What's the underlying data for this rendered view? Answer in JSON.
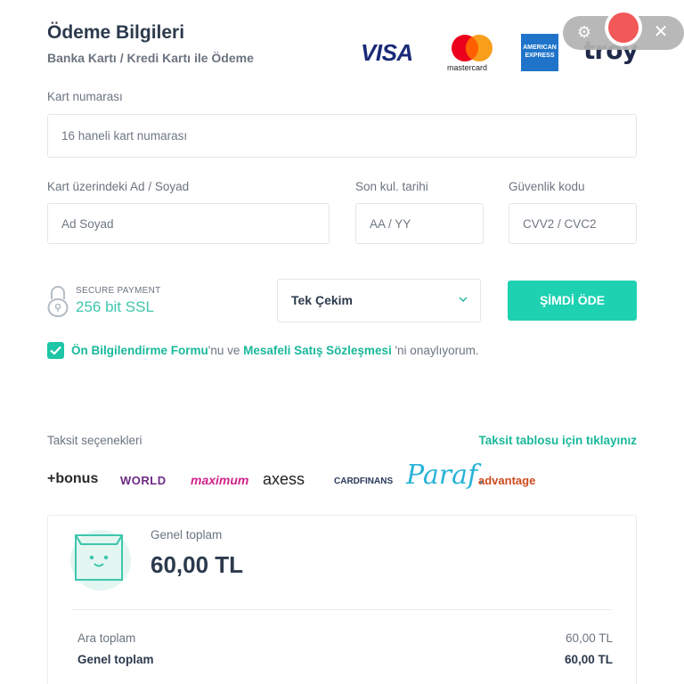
{
  "header": {
    "title": "Ödeme Bilgileri",
    "subtitle": "Banka Kartı / Kredi Kartı ile Ödeme"
  },
  "card_brands": {
    "visa": "VISA",
    "mastercard": "mastercard",
    "amex_line1": "AMERICAN",
    "amex_line2": "EXPRESS",
    "troy": "troy"
  },
  "form": {
    "card_number": {
      "label": "Kart numarası",
      "placeholder": "16 haneli kart numarası",
      "value": ""
    },
    "name": {
      "label": "Kart üzerindeki Ad / Soyad",
      "placeholder": "Ad Soyad",
      "value": ""
    },
    "expiry": {
      "label": "Son kul. tarihi",
      "placeholder": "AA / YY",
      "value": ""
    },
    "cvv": {
      "label": "Güvenlik kodu",
      "placeholder": "CVV2 / CVC2",
      "value": ""
    }
  },
  "secure": {
    "top": "SECURE PAYMENT",
    "main": "256 bit SSL"
  },
  "installment_select": {
    "selected": "Tek Çekim"
  },
  "pay_button": "ŞİMDİ ÖDE",
  "consent": {
    "checked": true,
    "link1": "Ön Bilgilendirme Formu",
    "text1": "'nu ve ",
    "link2": "Mesafeli Satış Sözleşmesi",
    "text2": " 'ni onaylıyorum."
  },
  "installments": {
    "label": "Taksit seçenekleri",
    "link": "Taksit tablosu için tıklayınız",
    "banks": [
      "+bonus",
      "WORLD",
      "maximum",
      "axess",
      "CARDFINANS",
      "Paraf.",
      "advantage"
    ]
  },
  "summary": {
    "total_label": "Genel toplam",
    "total_amount": "60,00 TL",
    "rows": [
      {
        "label": "Ara toplam",
        "value": "60,00 TL"
      },
      {
        "label": "Genel toplam",
        "value": "60,00 TL"
      }
    ]
  },
  "recorder": {
    "gear_icon": "gear-icon",
    "record_icon": "record-icon",
    "close_icon": "close-icon"
  },
  "colors": {
    "accent": "#1ed1b1",
    "link": "#1ab89b",
    "title": "#2c3a4d",
    "record": "#f04a4a"
  }
}
